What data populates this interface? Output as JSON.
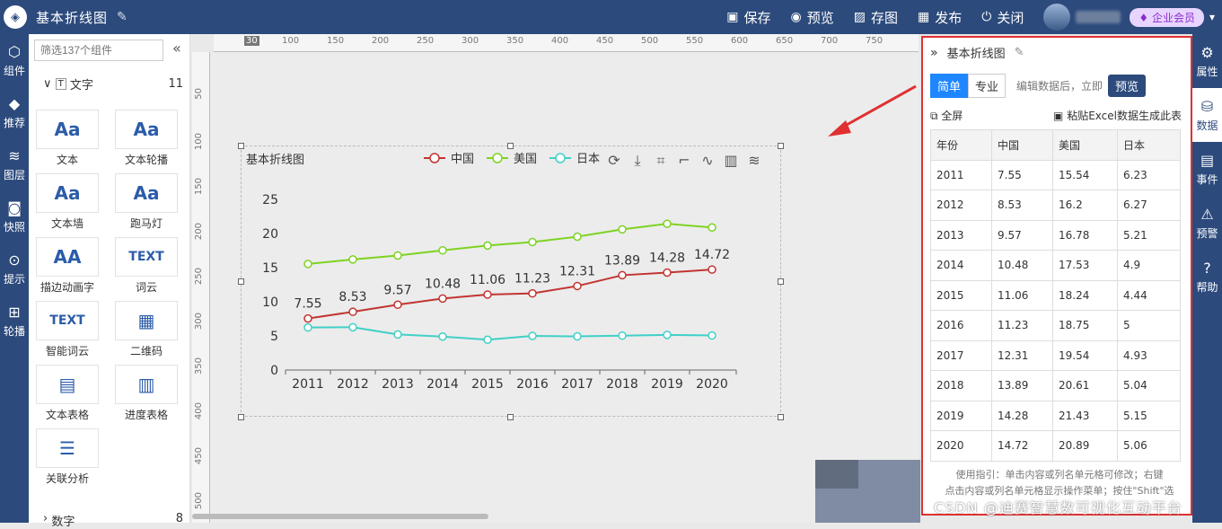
{
  "topbar": {
    "title": "基本折线图",
    "buttons": [
      {
        "label": "保存",
        "icon": "save-icon"
      },
      {
        "label": "预览",
        "icon": "preview-icon"
      },
      {
        "label": "存图",
        "icon": "image-icon"
      },
      {
        "label": "发布",
        "icon": "publish-icon"
      },
      {
        "label": "关闭",
        "icon": "power-icon"
      }
    ],
    "vip": "企业会员"
  },
  "leftnav": [
    {
      "label": "组件",
      "icon": "component-icon"
    },
    {
      "label": "推荐",
      "icon": "recommend-icon"
    },
    {
      "label": "图层",
      "icon": "layers-icon"
    },
    {
      "label": "快照",
      "icon": "camera-icon"
    },
    {
      "label": "提示",
      "icon": "tip-icon"
    },
    {
      "label": "轮播",
      "icon": "windows-icon"
    }
  ],
  "panel": {
    "search_placeholder": "筛选137个组件",
    "section_text": {
      "label": "文字",
      "count": "11"
    },
    "section_num": {
      "label": "数字",
      "count": "8"
    },
    "components": [
      {
        "label": "文本",
        "glyph": "Aa"
      },
      {
        "label": "文本轮播",
        "glyph": "Aa"
      },
      {
        "label": "文本墙",
        "glyph": "Aa"
      },
      {
        "label": "跑马灯",
        "glyph": "Aa"
      },
      {
        "label": "描边动画字",
        "glyph": "AA"
      },
      {
        "label": "词云",
        "glyph": "TEXT"
      },
      {
        "label": "智能词云",
        "glyph": "TEXT"
      },
      {
        "label": "二维码",
        "glyph": "▦"
      },
      {
        "label": "文本表格",
        "glyph": "▤"
      },
      {
        "label": "进度表格",
        "glyph": "▥"
      },
      {
        "label": "关联分析",
        "glyph": "☰"
      }
    ]
  },
  "ruler": {
    "top": [
      "30",
      "100",
      "150",
      "200",
      "250",
      "300",
      "350",
      "400",
      "450",
      "500",
      "550",
      "600",
      "650",
      "700",
      "750"
    ],
    "left": [
      "50",
      "100",
      "150",
      "200",
      "250",
      "300",
      "350",
      "400",
      "450",
      "500"
    ]
  },
  "chart_data": {
    "type": "line",
    "title": "基本折线图",
    "categories": [
      "2011",
      "2012",
      "2013",
      "2014",
      "2015",
      "2016",
      "2017",
      "2018",
      "2019",
      "2020"
    ],
    "ylim": [
      0,
      25
    ],
    "yticks": [
      "0",
      "5",
      "10",
      "15",
      "20",
      "25"
    ],
    "series": [
      {
        "name": "中国",
        "color": "#c23531",
        "values": [
          7.55,
          8.53,
          9.57,
          10.48,
          11.06,
          11.23,
          12.31,
          13.89,
          14.28,
          14.72
        ],
        "labels": true
      },
      {
        "name": "美国",
        "color": "#7ed321",
        "values": [
          15.54,
          16.2,
          16.78,
          17.53,
          18.24,
          18.75,
          19.54,
          20.61,
          21.43,
          20.89
        ],
        "labels": false
      },
      {
        "name": "日本",
        "color": "#40d0c8",
        "values": [
          6.23,
          6.27,
          5.21,
          4.9,
          4.44,
          5,
          4.93,
          5.04,
          5.15,
          5.06
        ],
        "labels": false
      }
    ],
    "toolbox": [
      "refresh-icon",
      "download-icon",
      "crop-icon",
      "crop-reset-icon",
      "line-switch-icon",
      "bar-switch-icon",
      "stack-icon"
    ]
  },
  "rpanel": {
    "title": "基本折线图",
    "tab_simple": "简单",
    "tab_pro": "专业",
    "hint": "编辑数据后，立即",
    "preview": "预览",
    "fullscreen": "全屏",
    "paste": "粘贴Excel数据生成此表",
    "headers": [
      "年份",
      "中国",
      "美国",
      "日本"
    ],
    "rows": [
      [
        "2011",
        "7.55",
        "15.54",
        "6.23"
      ],
      [
        "2012",
        "8.53",
        "16.2",
        "6.27"
      ],
      [
        "2013",
        "9.57",
        "16.78",
        "5.21"
      ],
      [
        "2014",
        "10.48",
        "17.53",
        "4.9"
      ],
      [
        "2015",
        "11.06",
        "18.24",
        "4.44"
      ],
      [
        "2016",
        "11.23",
        "18.75",
        "5"
      ],
      [
        "2017",
        "12.31",
        "19.54",
        "4.93"
      ],
      [
        "2018",
        "13.89",
        "20.61",
        "5.04"
      ],
      [
        "2019",
        "14.28",
        "21.43",
        "5.15"
      ],
      [
        "2020",
        "14.72",
        "20.89",
        "5.06"
      ]
    ],
    "guide1": "使用指引：单击内容或列名单元格可修改；右键",
    "guide2": "点击内容或列名单元格显示操作菜单；按住\"Shift\"选"
  },
  "watermark": "CSDN @迪赛智慧数可视化互动平台",
  "rightnav": [
    {
      "label": "属性",
      "icon": "properties-icon"
    },
    {
      "label": "数据",
      "icon": "database-icon"
    },
    {
      "label": "事件",
      "icon": "event-icon"
    },
    {
      "label": "预警",
      "icon": "alarm-icon"
    },
    {
      "label": "帮助",
      "icon": "help-icon"
    }
  ]
}
